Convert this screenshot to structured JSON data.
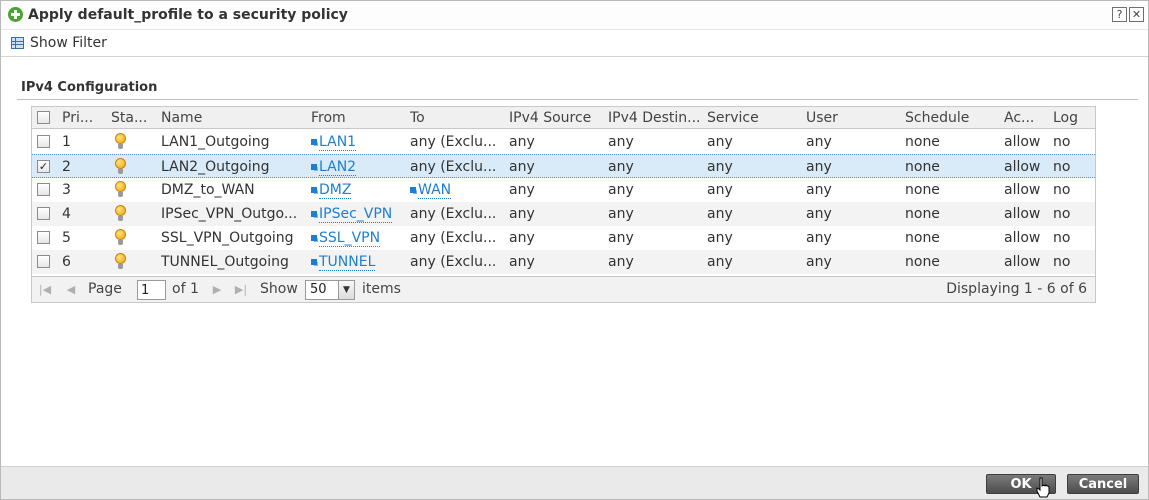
{
  "dialog": {
    "title": "Apply default_profile to a security policy",
    "help_glyph": "?",
    "close_glyph": "✕",
    "title_icon": "add-circle-icon"
  },
  "filter": {
    "label": "Show Filter",
    "icon": "filter-table-icon"
  },
  "section": {
    "title": "IPv4 Configuration"
  },
  "table": {
    "headers": [
      "Pri...",
      "Sta...",
      "Name",
      "From",
      "To",
      "IPv4 Source",
      "IPv4 Destin...",
      "Service",
      "User",
      "Schedule",
      "Ac...",
      "Log"
    ],
    "rows": [
      {
        "priority": "1",
        "name": "LAN1_Outgoing",
        "from": "LAN1",
        "to": "any (Exclu...",
        "src": "any",
        "dst": "any",
        "service": "any",
        "user": "any",
        "schedule": "none",
        "action": "allow",
        "log": "no",
        "checked": false
      },
      {
        "priority": "2",
        "name": "LAN2_Outgoing",
        "from": "LAN2",
        "to": "any (Exclu...",
        "src": "any",
        "dst": "any",
        "service": "any",
        "user": "any",
        "schedule": "none",
        "action": "allow",
        "log": "no",
        "checked": true
      },
      {
        "priority": "3",
        "name": "DMZ_to_WAN",
        "from": "DMZ",
        "to": "WAN",
        "src": "any",
        "dst": "any",
        "service": "any",
        "user": "any",
        "schedule": "none",
        "action": "allow",
        "log": "no",
        "checked": false
      },
      {
        "priority": "4",
        "name": "IPSec_VPN_Outgo...",
        "from": "IPSec_VPN",
        "to": "any (Exclu...",
        "src": "any",
        "dst": "any",
        "service": "any",
        "user": "any",
        "schedule": "none",
        "action": "allow",
        "log": "no",
        "checked": false
      },
      {
        "priority": "5",
        "name": "SSL_VPN_Outgoing",
        "from": "SSL_VPN",
        "to": "any (Exclu...",
        "src": "any",
        "dst": "any",
        "service": "any",
        "user": "any",
        "schedule": "none",
        "action": "allow",
        "log": "no",
        "checked": false
      },
      {
        "priority": "6",
        "name": "TUNNEL_Outgoing",
        "from": "TUNNEL",
        "to": "any (Exclu...",
        "src": "any",
        "dst": "any",
        "service": "any",
        "user": "any",
        "schedule": "none",
        "action": "allow",
        "log": "no",
        "checked": false
      }
    ]
  },
  "pager": {
    "page_label": "Page",
    "page_value": "1",
    "of_label": "of 1",
    "show_label": "Show",
    "show_value": "50",
    "items_label": "items",
    "displaying": "Displaying 1 - 6 of 6"
  },
  "footer": {
    "ok_label": "OK",
    "cancel_label": "Cancel"
  },
  "colors": {
    "link": "#1e7fd0",
    "selected_row": "#d9eaf8",
    "button": "#5c5c5c"
  }
}
